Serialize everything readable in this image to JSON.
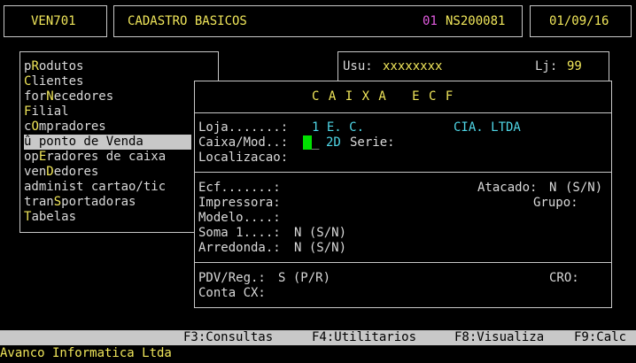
{
  "header": {
    "program": "VEN701",
    "module": "CADASTRO BASICOS",
    "company_code": "01",
    "terminal": "NS200081",
    "date": "01/09/16"
  },
  "status": {
    "user_label": "Usu:",
    "user_value": "xxxxxxxx",
    "store_label": "Lj:",
    "store_value": "99"
  },
  "menu": {
    "items": [
      {
        "pre": "p",
        "hot": "R",
        "post": "odutos"
      },
      {
        "pre": "",
        "hot": "C",
        "post": "lientes"
      },
      {
        "pre": "for",
        "hot": "N",
        "post": "ecedores"
      },
      {
        "pre": "",
        "hot": "F",
        "post": "ilial"
      },
      {
        "pre": "c",
        "hot": "O",
        "post": "mpradores"
      },
      {
        "pre": "û ponto de Venda",
        "hot": "",
        "post": ""
      },
      {
        "pre": "op",
        "hot": "E",
        "post": "radores de caixa"
      },
      {
        "pre": "ven",
        "hot": "D",
        "post": "edores"
      },
      {
        "pre": "administ cartao/tic",
        "hot": "",
        "post": ""
      },
      {
        "pre": "tran",
        "hot": "S",
        "post": "portadoras"
      },
      {
        "pre": "",
        "hot": "T",
        "post": "abelas"
      }
    ]
  },
  "dialog": {
    "title": "C A I X A   E C F",
    "loja_label": "Loja.......:",
    "loja_value": "1 E. C.",
    "loja_company": "CIA. LTDA",
    "caixa_label": "Caixa/Mod..:",
    "caixa_mod": "2D",
    "serie_label": "Serie:",
    "localizacao_label": "Localizacao:",
    "ecf_label": "Ecf.......:",
    "atacado_label": "Atacado:",
    "atacado_value": "N",
    "atacado_hint": "(S/N)",
    "impressora_label": "Impressora:",
    "grupo_label": "Grupo:",
    "modelo_label": "Modelo....:",
    "soma_label": "Soma 1....:",
    "soma_value": "N (S/N)",
    "arredonda_label": "Arredonda.:",
    "arredonda_value": "N (S/N)",
    "pdv_label": "PDV/Reg.:",
    "pdv_value": "S (P/R)",
    "cro_label": "CRO:",
    "conta_label": "Conta CX:"
  },
  "function_keys": {
    "f3": "F3:Consultas",
    "f4": "F4:Utilitarios",
    "f8": "F8:Visualiza",
    "f9": "F9:Calc"
  },
  "footer": {
    "company": "Avanco Informatica Ltda"
  },
  "colors": {
    "background": "#000000",
    "text": "#d9d9d9",
    "highlight": "#f0e65a",
    "accent_magenta": "#e25ce0",
    "accent_cyan": "#4fd6e6",
    "cursor": "#00e000",
    "bar": "#c8c8c8"
  }
}
